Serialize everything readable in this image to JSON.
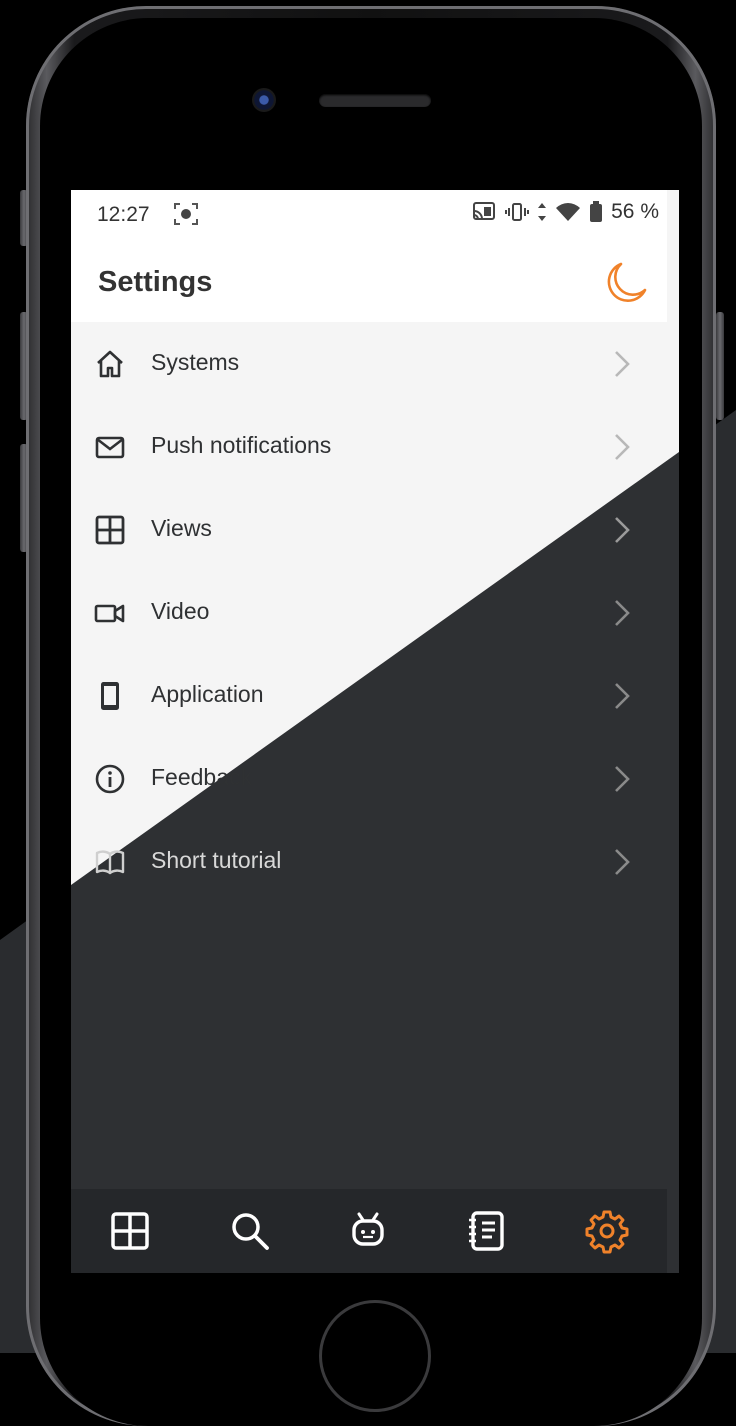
{
  "status_bar": {
    "time": "12:27",
    "battery_text": "56 %",
    "icons": [
      "screen-record-icon",
      "cast-icon",
      "vibrate-icon",
      "data-arrows-icon",
      "wifi-icon",
      "battery-icon"
    ]
  },
  "header": {
    "title": "Settings",
    "theme_toggle_icon": "moon-icon"
  },
  "menu": {
    "items": [
      {
        "label": "Systems",
        "icon": "home-icon"
      },
      {
        "label": "Push notifications",
        "icon": "envelope-icon"
      },
      {
        "label": "Views",
        "icon": "grid-icon"
      },
      {
        "label": "Video",
        "icon": "video-camera-icon"
      },
      {
        "label": "Application",
        "icon": "phone-device-icon"
      },
      {
        "label": "Feedback",
        "icon": "info-icon"
      },
      {
        "label": "Short tutorial",
        "icon": "book-icon"
      }
    ]
  },
  "bottom_nav": {
    "items": [
      "grid-icon",
      "search-icon",
      "robot-icon",
      "notebook-icon",
      "gear-icon"
    ],
    "active": "gear-icon"
  },
  "colors": {
    "accent": "#f0822a",
    "light_bg": "#f5f5f5",
    "dark_bg": "#2e3033",
    "nav_bg": "#25272a",
    "text": "#2f3133"
  }
}
